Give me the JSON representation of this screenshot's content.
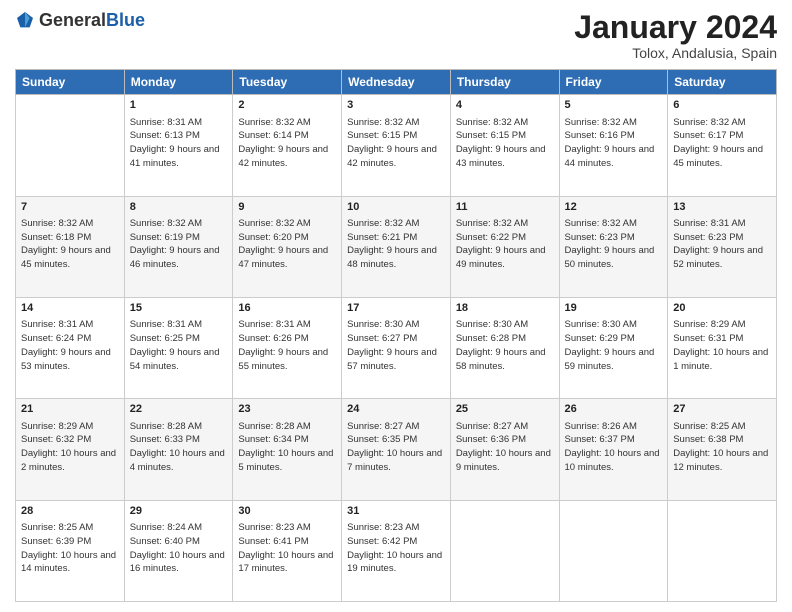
{
  "header": {
    "logo_general": "General",
    "logo_blue": "Blue",
    "month_title": "January 2024",
    "subtitle": "Tolox, Andalusia, Spain"
  },
  "days_of_week": [
    "Sunday",
    "Monday",
    "Tuesday",
    "Wednesday",
    "Thursday",
    "Friday",
    "Saturday"
  ],
  "weeks": [
    [
      {
        "day": "",
        "sunrise": "",
        "sunset": "",
        "daylight": ""
      },
      {
        "day": "1",
        "sunrise": "Sunrise: 8:31 AM",
        "sunset": "Sunset: 6:13 PM",
        "daylight": "Daylight: 9 hours and 41 minutes."
      },
      {
        "day": "2",
        "sunrise": "Sunrise: 8:32 AM",
        "sunset": "Sunset: 6:14 PM",
        "daylight": "Daylight: 9 hours and 42 minutes."
      },
      {
        "day": "3",
        "sunrise": "Sunrise: 8:32 AM",
        "sunset": "Sunset: 6:15 PM",
        "daylight": "Daylight: 9 hours and 42 minutes."
      },
      {
        "day": "4",
        "sunrise": "Sunrise: 8:32 AM",
        "sunset": "Sunset: 6:15 PM",
        "daylight": "Daylight: 9 hours and 43 minutes."
      },
      {
        "day": "5",
        "sunrise": "Sunrise: 8:32 AM",
        "sunset": "Sunset: 6:16 PM",
        "daylight": "Daylight: 9 hours and 44 minutes."
      },
      {
        "day": "6",
        "sunrise": "Sunrise: 8:32 AM",
        "sunset": "Sunset: 6:17 PM",
        "daylight": "Daylight: 9 hours and 45 minutes."
      }
    ],
    [
      {
        "day": "7",
        "sunrise": "Sunrise: 8:32 AM",
        "sunset": "Sunset: 6:18 PM",
        "daylight": "Daylight: 9 hours and 45 minutes."
      },
      {
        "day": "8",
        "sunrise": "Sunrise: 8:32 AM",
        "sunset": "Sunset: 6:19 PM",
        "daylight": "Daylight: 9 hours and 46 minutes."
      },
      {
        "day": "9",
        "sunrise": "Sunrise: 8:32 AM",
        "sunset": "Sunset: 6:20 PM",
        "daylight": "Daylight: 9 hours and 47 minutes."
      },
      {
        "day": "10",
        "sunrise": "Sunrise: 8:32 AM",
        "sunset": "Sunset: 6:21 PM",
        "daylight": "Daylight: 9 hours and 48 minutes."
      },
      {
        "day": "11",
        "sunrise": "Sunrise: 8:32 AM",
        "sunset": "Sunset: 6:22 PM",
        "daylight": "Daylight: 9 hours and 49 minutes."
      },
      {
        "day": "12",
        "sunrise": "Sunrise: 8:32 AM",
        "sunset": "Sunset: 6:23 PM",
        "daylight": "Daylight: 9 hours and 50 minutes."
      },
      {
        "day": "13",
        "sunrise": "Sunrise: 8:31 AM",
        "sunset": "Sunset: 6:23 PM",
        "daylight": "Daylight: 9 hours and 52 minutes."
      }
    ],
    [
      {
        "day": "14",
        "sunrise": "Sunrise: 8:31 AM",
        "sunset": "Sunset: 6:24 PM",
        "daylight": "Daylight: 9 hours and 53 minutes."
      },
      {
        "day": "15",
        "sunrise": "Sunrise: 8:31 AM",
        "sunset": "Sunset: 6:25 PM",
        "daylight": "Daylight: 9 hours and 54 minutes."
      },
      {
        "day": "16",
        "sunrise": "Sunrise: 8:31 AM",
        "sunset": "Sunset: 6:26 PM",
        "daylight": "Daylight: 9 hours and 55 minutes."
      },
      {
        "day": "17",
        "sunrise": "Sunrise: 8:30 AM",
        "sunset": "Sunset: 6:27 PM",
        "daylight": "Daylight: 9 hours and 57 minutes."
      },
      {
        "day": "18",
        "sunrise": "Sunrise: 8:30 AM",
        "sunset": "Sunset: 6:28 PM",
        "daylight": "Daylight: 9 hours and 58 minutes."
      },
      {
        "day": "19",
        "sunrise": "Sunrise: 8:30 AM",
        "sunset": "Sunset: 6:29 PM",
        "daylight": "Daylight: 9 hours and 59 minutes."
      },
      {
        "day": "20",
        "sunrise": "Sunrise: 8:29 AM",
        "sunset": "Sunset: 6:31 PM",
        "daylight": "Daylight: 10 hours and 1 minute."
      }
    ],
    [
      {
        "day": "21",
        "sunrise": "Sunrise: 8:29 AM",
        "sunset": "Sunset: 6:32 PM",
        "daylight": "Daylight: 10 hours and 2 minutes."
      },
      {
        "day": "22",
        "sunrise": "Sunrise: 8:28 AM",
        "sunset": "Sunset: 6:33 PM",
        "daylight": "Daylight: 10 hours and 4 minutes."
      },
      {
        "day": "23",
        "sunrise": "Sunrise: 8:28 AM",
        "sunset": "Sunset: 6:34 PM",
        "daylight": "Daylight: 10 hours and 5 minutes."
      },
      {
        "day": "24",
        "sunrise": "Sunrise: 8:27 AM",
        "sunset": "Sunset: 6:35 PM",
        "daylight": "Daylight: 10 hours and 7 minutes."
      },
      {
        "day": "25",
        "sunrise": "Sunrise: 8:27 AM",
        "sunset": "Sunset: 6:36 PM",
        "daylight": "Daylight: 10 hours and 9 minutes."
      },
      {
        "day": "26",
        "sunrise": "Sunrise: 8:26 AM",
        "sunset": "Sunset: 6:37 PM",
        "daylight": "Daylight: 10 hours and 10 minutes."
      },
      {
        "day": "27",
        "sunrise": "Sunrise: 8:25 AM",
        "sunset": "Sunset: 6:38 PM",
        "daylight": "Daylight: 10 hours and 12 minutes."
      }
    ],
    [
      {
        "day": "28",
        "sunrise": "Sunrise: 8:25 AM",
        "sunset": "Sunset: 6:39 PM",
        "daylight": "Daylight: 10 hours and 14 minutes."
      },
      {
        "day": "29",
        "sunrise": "Sunrise: 8:24 AM",
        "sunset": "Sunset: 6:40 PM",
        "daylight": "Daylight: 10 hours and 16 minutes."
      },
      {
        "day": "30",
        "sunrise": "Sunrise: 8:23 AM",
        "sunset": "Sunset: 6:41 PM",
        "daylight": "Daylight: 10 hours and 17 minutes."
      },
      {
        "day": "31",
        "sunrise": "Sunrise: 8:23 AM",
        "sunset": "Sunset: 6:42 PM",
        "daylight": "Daylight: 10 hours and 19 minutes."
      },
      {
        "day": "",
        "sunrise": "",
        "sunset": "",
        "daylight": ""
      },
      {
        "day": "",
        "sunrise": "",
        "sunset": "",
        "daylight": ""
      },
      {
        "day": "",
        "sunrise": "",
        "sunset": "",
        "daylight": ""
      }
    ]
  ]
}
